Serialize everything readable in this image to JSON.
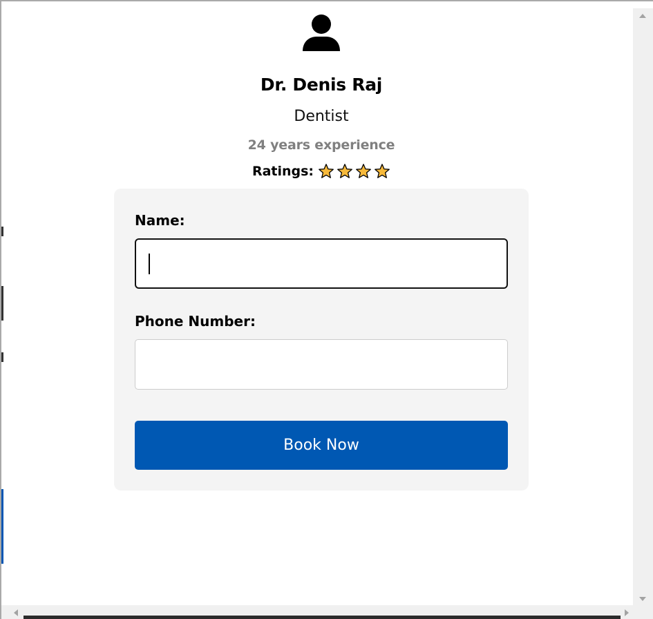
{
  "doctor": {
    "name": "Dr. Denis Raj",
    "specialty": "Dentist",
    "experience": "24 years experience",
    "ratings_label": "Ratings:",
    "rating_stars": 4
  },
  "form": {
    "name_label": "Name:",
    "name_value": "",
    "phone_label": "Phone Number:",
    "phone_value": "",
    "submit_label": "Book Now"
  },
  "icons": {
    "avatar": "user-icon",
    "star": "star-icon"
  },
  "colors": {
    "primary": "#0058b3",
    "star_fill": "#f6b93b",
    "muted_text": "#808080",
    "card_bg": "#f4f4f4"
  }
}
